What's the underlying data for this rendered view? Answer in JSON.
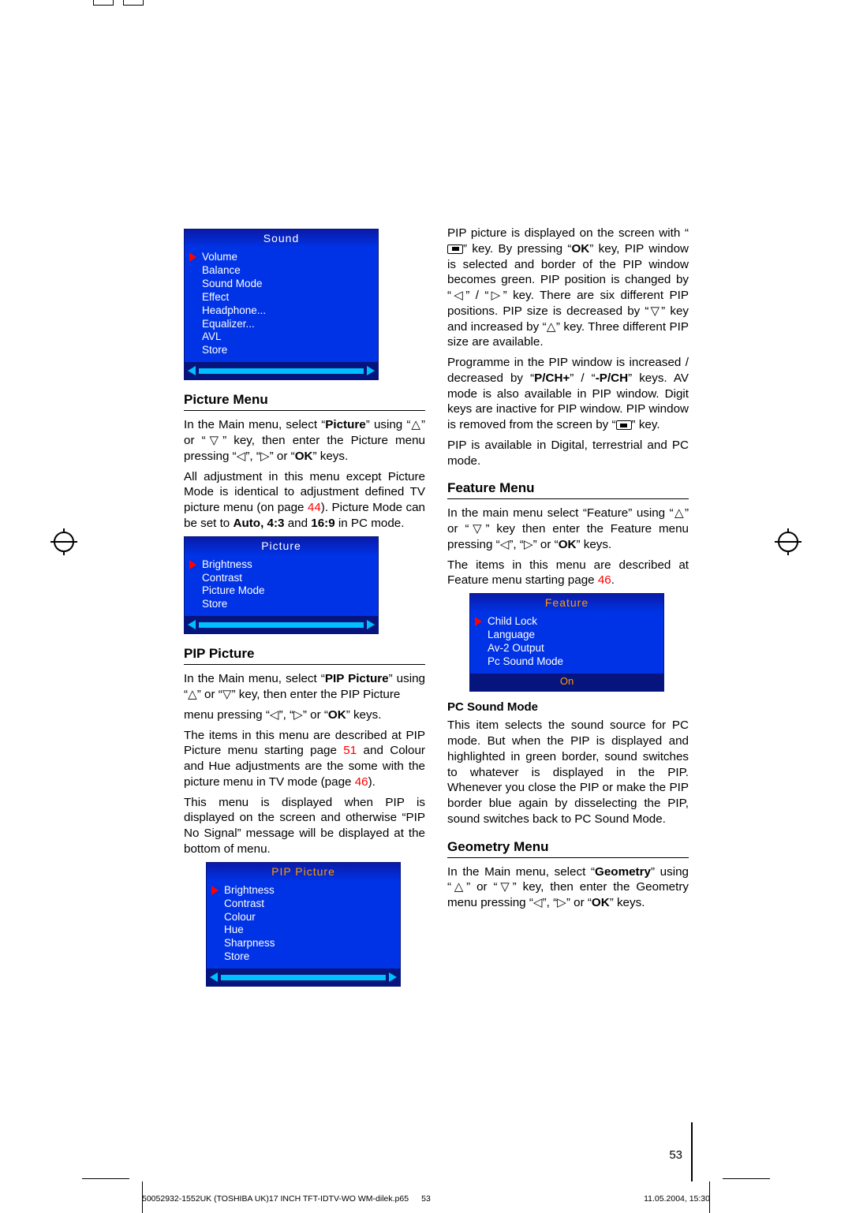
{
  "page_number": "53",
  "footer": {
    "left": "50052932-1552UK (TOSHIBA UK)17 INCH TFT-IDTV-WO WM-dilek.p65",
    "center": "53",
    "right": "11.05.2004, 15:30"
  },
  "osd": {
    "sound": {
      "title": "Sound",
      "items": [
        "Volume",
        "Balance",
        "Sound Mode",
        "Effect",
        "Headphone...",
        "Equalizer...",
        "AVL",
        "Store"
      ]
    },
    "picture": {
      "title": "Picture",
      "items": [
        "Brightness",
        "Contrast",
        "Picture Mode",
        "Store"
      ]
    },
    "pip": {
      "title": "PIP Picture",
      "items": [
        "Brightness",
        "Contrast",
        "Colour",
        "Hue",
        "Sharpness",
        "Store"
      ]
    },
    "feature": {
      "title": "Feature",
      "items": [
        "Child Lock",
        "Language",
        "Av-2 Output",
        "Pc Sound Mode"
      ],
      "value": "On"
    }
  },
  "left_col": {
    "h1": "Picture Menu",
    "p1a": "In the Main menu, select “",
    "p1b": "Picture",
    "p1c": "” using “",
    "p1d": "” or “",
    "p1e": "” key, then enter the Picture menu pressing “",
    "p1f": "”, “",
    "p1g": "” or “",
    "p1h": "OK",
    "p1i": "” keys.",
    "p2a": "All adjustment in this menu except Picture Mode is identical to adjustment defined TV picture menu (on page ",
    "p2b": "44",
    "p2c": "). Picture Mode can be set to ",
    "p2d": "Auto, 4:3",
    "p2e": " and ",
    "p2f": "16:9",
    "p2g": " in PC mode.",
    "h2": "PIP Picture",
    "p3a": "In the Main menu, select “",
    "p3b": "PIP Picture",
    "p3c": "” using “",
    "p3d": "” or “",
    "p3e": "” key, then enter the PIP Picture",
    "p4a": "menu pressing “",
    "p4b": "”, “",
    "p4c": "” or “",
    "p4d": "OK",
    "p4e": "” keys.",
    "p5a": "The items in this menu are described at PIP Picture menu starting page ",
    "p5b": "51",
    "p5c": " and Colour and Hue adjustments are the some with the picture menu in TV mode (page ",
    "p5d": "46",
    "p5e": ").",
    "p6": "This menu is displayed when PIP is displayed on the screen and otherwise “PIP No Signal” message will be displayed at the bottom of menu."
  },
  "right_col": {
    "p1a": "PIP picture is displayed on the screen with “",
    "p1b": "” key. By pressing “",
    "p1c": "OK",
    "p1d": "” key, PIP window is selected and border of the PIP window becomes green. PIP position is changed by “",
    "p1e": "” / “",
    "p1f": "” key. There are six different PIP positions. PIP size is decreased by “",
    "p1g": "” key and increased by “",
    "p1h": "” key. Three different PIP size are available.",
    "p2a": "Programme in the PIP window is increased / decreased by “",
    "p2b": "P/CH+",
    "p2c": "” / “",
    "p2d": "-P/CH",
    "p2e": "” keys. AV mode is also available in PIP window. Digit keys are inactive for PIP window. PIP window is removed from the screen by “",
    "p2f": "” key.",
    "p3": "PIP is available in Digital, terrestrial and PC mode.",
    "h1": "Feature Menu",
    "p4a": "In the main menu select “Feature” using “",
    "p4b": "” or “",
    "p4c": "” key then enter the Feature menu pressing “",
    "p4d": "”, “",
    "p4e": "” or “",
    "p4f": "OK",
    "p4g": "” keys.",
    "p5a": "The items in this menu are described at Feature menu starting page ",
    "p5b": "46",
    "p5c": ".",
    "sub1": "PC Sound Mode",
    "p6": "This item selects the sound source for PC mode. But when the PIP is displayed and highlighted in green border, sound switches to whatever is displayed in the PIP.  Whenever you close the PIP or make the PIP border blue again by disselecting the PIP, sound switches back to PC Sound Mode.",
    "h2": "Geometry Menu",
    "p7a": "In the Main menu, select “",
    "p7b": "Geometry",
    "p7c": "” using “",
    "p7d": "” or “",
    "p7e": "” key, then enter the Geometry menu pressing “",
    "p7f": "”, “",
    "p7g": "” or “",
    "p7h": "OK",
    "p7i": "” keys."
  },
  "glyphs": {
    "up": "△",
    "down": "▽",
    "left": "◁",
    "right": "▷"
  }
}
